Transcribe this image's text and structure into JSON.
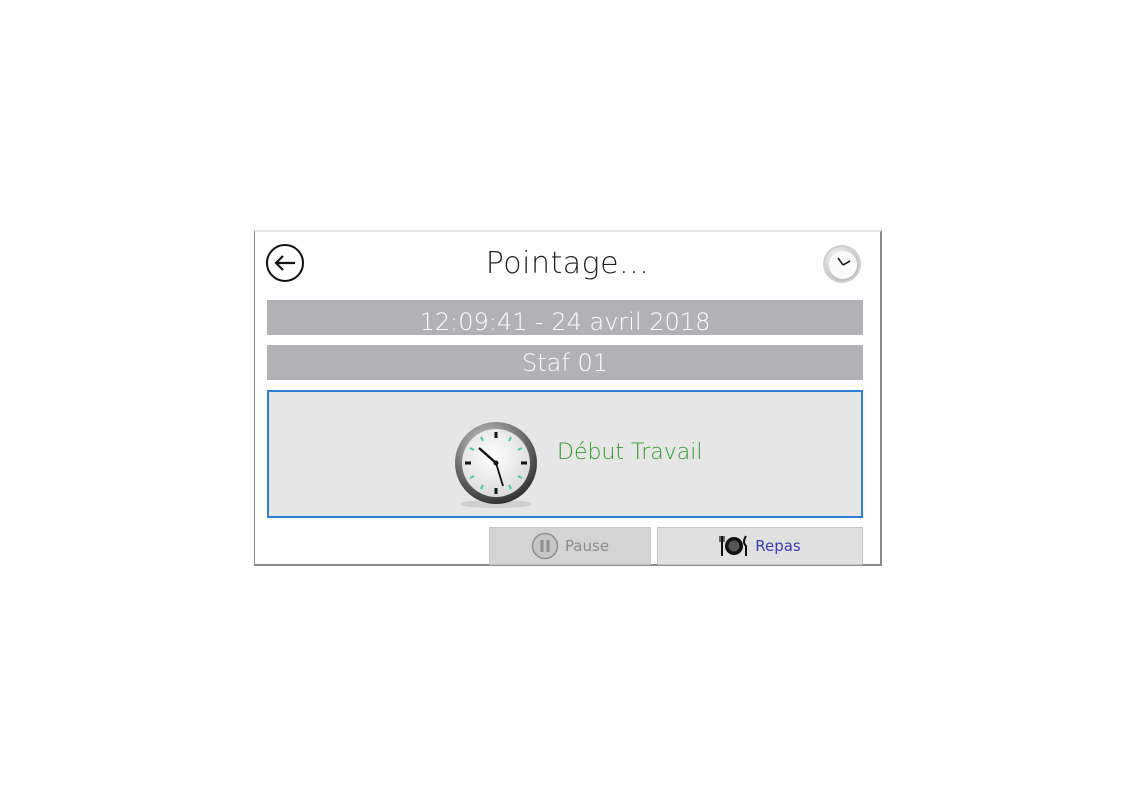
{
  "dialog": {
    "title": "Pointage...",
    "datetime": "12:09:41 - 24 avril 2018",
    "staff": "Staf 01",
    "main_action": {
      "label": "Début Travail",
      "label_color": "#2e9a2e",
      "icon": "clock-icon"
    },
    "buttons": {
      "pause_label": "Pause",
      "meal_label": "Repas"
    },
    "icons": {
      "back": "back-arrow-icon",
      "header": "clock-icon",
      "pause": "pause-icon",
      "meal": "plate-cutlery-icon"
    },
    "colors": {
      "bar_bg": "#b2b1b6",
      "focus_border": "#2b7fd4",
      "meal_text": "#3b3bb0"
    }
  }
}
